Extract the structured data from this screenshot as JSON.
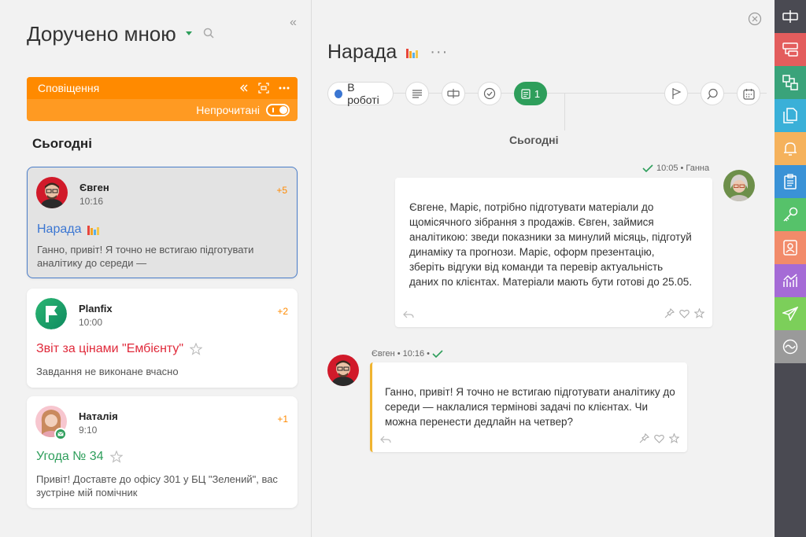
{
  "left": {
    "title": "Доручено мною",
    "notifications": {
      "label": "Сповіщення",
      "unread_label": "Непрочитані"
    },
    "section_today": "Сьогодні",
    "cards": [
      {
        "name": "Євген",
        "time": "10:16",
        "count": "+5",
        "task": "Нарада",
        "task_color": "#3b76d2",
        "preview": "Ганно, привіт! Я точно не встигаю підготувати аналітику до середи —"
      },
      {
        "name": "Planfix",
        "time": "10:00",
        "count": "+2",
        "task": "Звіт за цінами \"Ембієнту\"",
        "task_color": "#e0293a",
        "preview": "Завдання не виконане вчасно"
      },
      {
        "name": "Наталія",
        "time": "9:10",
        "count": "+1",
        "task": "Угода № 34",
        "task_color": "#2e9e5b",
        "preview": "Привіт! Доставте до офісу 301 у БЦ \"Зелений\", вас зустріне мій помічник"
      }
    ]
  },
  "center": {
    "title": "Нарада",
    "more": "···",
    "status_label": "В роботі",
    "chat_count": "1",
    "day_label": "Сьогодні",
    "messages": [
      {
        "time": "10:05",
        "author": "Ганна",
        "text": "Євгене, Маріє, потрібно підготувати матеріали до щомісячного зібрання з продажів. Євген, займися аналітикою: зведи показники за минулий місяць, підготуй динаміку та прогнози. Маріє, оформ презентацію, зберіть відгуки від команди та перевір актуальність даних по клієнтах. Матеріали мають бути готові до 25.05."
      },
      {
        "time": "10:16",
        "author": "Євген",
        "text": "Ганно, привіт! Я точно не встигаю підготувати аналітику до середи — наклалися термінові задачі по клієнтах. Чи можна перенести дедлайн на четвер?"
      }
    ]
  },
  "colors": {
    "accent_green": "#2e9e5b",
    "accent_orange": "#ff8a00",
    "status_blue": "#3b76d2",
    "rail_bg": "#4a4a52"
  },
  "rail": [
    {
      "icon": "fix-icon",
      "color": "#4a4a52"
    },
    {
      "icon": "tasks-icon",
      "color": "#e35d5d"
    },
    {
      "icon": "projects-icon",
      "color": "#3aa37a"
    },
    {
      "icon": "documents-icon",
      "color": "#3ab0d8"
    },
    {
      "icon": "bell-icon",
      "color": "#f5b25c"
    },
    {
      "icon": "clipboard-icon",
      "color": "#3a92d6"
    },
    {
      "icon": "key-icon",
      "color": "#56c26a"
    },
    {
      "icon": "contacts-icon",
      "color": "#f28b6a"
    },
    {
      "icon": "reports-icon",
      "color": "#a56bd6"
    },
    {
      "icon": "send-icon",
      "color": "#7ccf5a"
    },
    {
      "icon": "analytics-icon",
      "color": "#9a9a9a"
    }
  ]
}
